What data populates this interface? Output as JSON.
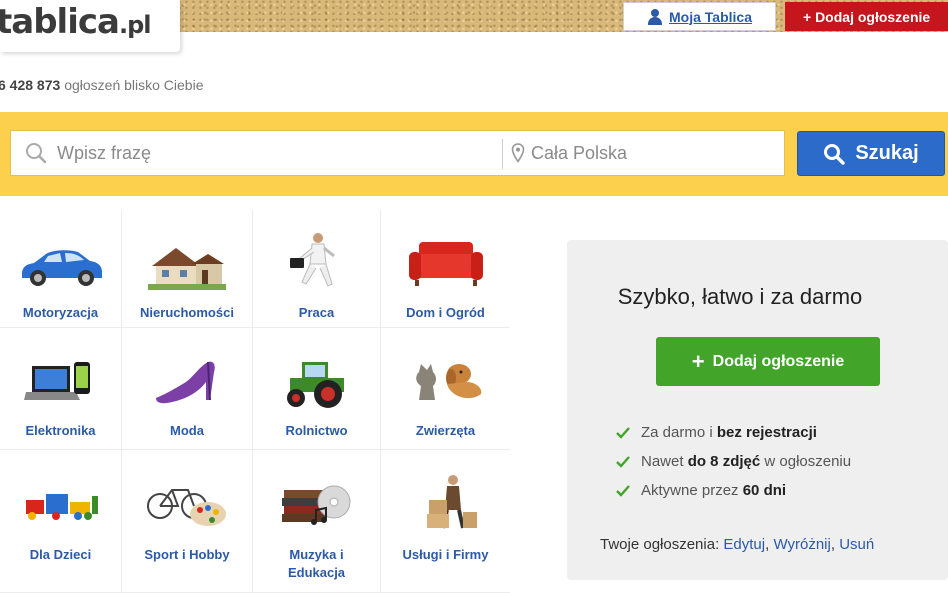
{
  "header": {
    "logo_main": "tablica",
    "logo_suffix": ".pl",
    "moja_tablica": "Moja Tablica",
    "dodaj_top": "+ Dodaj ogłoszenie"
  },
  "stats": {
    "count": "6 428 873",
    "count_text": "ogłoszeń blisko Ciebie"
  },
  "search": {
    "phrase_placeholder": "Wpisz frazę",
    "location_placeholder": "Cała Polska",
    "button_label": "Szukaj"
  },
  "categories": [
    {
      "label": "Motoryzacja",
      "icon": "car-icon"
    },
    {
      "label": "Nieruchomości",
      "icon": "house-icon"
    },
    {
      "label": "Praca",
      "icon": "businessman-icon"
    },
    {
      "label": "Dom i Ogród",
      "icon": "sofa-icon"
    },
    {
      "label": "Elektronika",
      "icon": "laptop-phone-icon"
    },
    {
      "label": "Moda",
      "icon": "high-heel-icon"
    },
    {
      "label": "Rolnictwo",
      "icon": "tractor-icon"
    },
    {
      "label": "Zwierzęta",
      "icon": "cat-dog-icon"
    },
    {
      "label": "Dla Dzieci",
      "icon": "toy-train-icon"
    },
    {
      "label": "Sport i Hobby",
      "icon": "bike-palette-icon"
    },
    {
      "label": "Muzyka i Edukacja",
      "icon": "books-cd-icon"
    },
    {
      "label": "Usługi i Firmy",
      "icon": "mover-boxes-icon"
    }
  ],
  "promo": {
    "title": "Szybko, łatwo i za darmo",
    "button_label": "Dodaj ogłoszenie",
    "features": [
      {
        "pre": "Za darmo i ",
        "bold": "bez rejestracji",
        "post": ""
      },
      {
        "pre": "Nawet ",
        "bold": "do 8 zdjęć",
        "post": " w ogłoszeniu"
      },
      {
        "pre": "Aktywne przez ",
        "bold": "60 dni",
        "post": ""
      }
    ],
    "yours_label": "Twoje ogłoszenia:",
    "links": [
      "Edytuj",
      "Wyróżnij",
      "Usuń"
    ]
  },
  "colors": {
    "brand_yellow": "#fcd04d",
    "link_blue": "#2b5aa8",
    "search_button": "#2c6bc9",
    "add_green": "#42a52a",
    "top_red": "#c4161c"
  }
}
